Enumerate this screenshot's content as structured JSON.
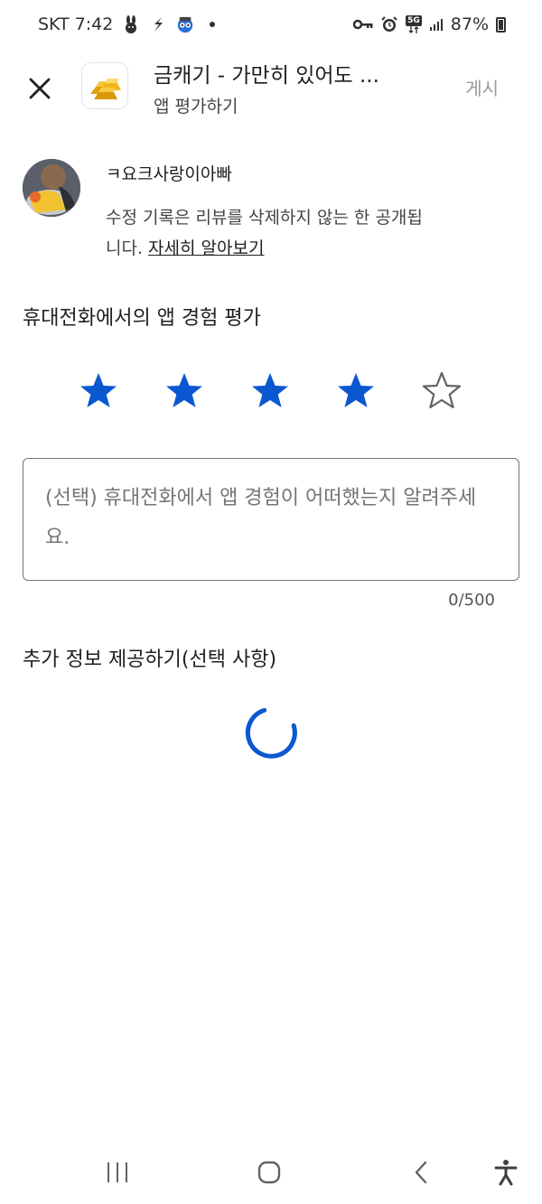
{
  "status_bar": {
    "carrier": "SKT",
    "time": "7:42",
    "network": "5G",
    "battery": "87%"
  },
  "app_bar": {
    "title": "금캐기 - 가만히 있어도 ...",
    "subtitle": "앱 평가하기",
    "post_label": "게시"
  },
  "user": {
    "name": "ㅋ요크사랑이아빠",
    "notice": "수정 기록은 리뷰를 삭제하지 않는 한 공개됩니다. ",
    "learn_more": "자세히 알아보기"
  },
  "rating": {
    "title": "휴대전화에서의 앱 경험 평가",
    "value": 4,
    "max": 5,
    "accent_color": "#0b57d0",
    "empty_color": "#5f6368"
  },
  "review": {
    "placeholder": "(선택) 휴대전화에서 앱 경험이 어떠했는지 알려주세요.",
    "counter": "0/500"
  },
  "extra": {
    "title": "추가 정보 제공하기(선택 사항)",
    "loading": true
  },
  "nav": {
    "icons": [
      "recent-apps-icon",
      "home-icon",
      "back-icon",
      "accessibility-icon"
    ]
  }
}
